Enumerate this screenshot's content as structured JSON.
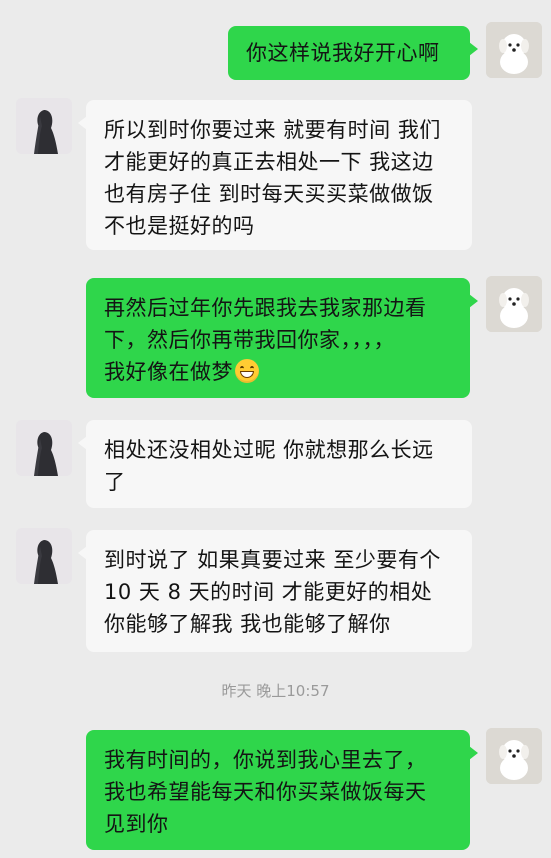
{
  "messages": [
    {
      "side": "right",
      "text": "你这样说我好开心啊"
    },
    {
      "side": "left",
      "lines": [
        "所以到时你要过来 就要有时间 我们",
        "才能更好的真正去相处一下 我这边",
        "也有房子住 到时每天买买菜做做饭",
        "不也是挺好的吗"
      ]
    },
    {
      "side": "right",
      "lines": [
        "再然后过年你先跟我去我家那边看",
        "下，然后你再带我回你家，，，，",
        "我好像在做梦"
      ],
      "emoji": "grinning-face-emoji"
    },
    {
      "side": "left",
      "lines": [
        "相处还没相处过昵 你就想那么长远",
        "了"
      ]
    },
    {
      "side": "left",
      "lines": [
        "到时说了 如果真要过来 至少要有个",
        "10 天 8 天的时间 才能更好的相处",
        "你能够了解我 我也能够了解你"
      ]
    },
    {
      "side": "right",
      "lines": [
        "我有时间的，你说到我心里去了，",
        "我也希望能每天和你买菜做饭每天",
        "见到你"
      ]
    }
  ],
  "timestamp": "昨天 晚上10:57",
  "avatars": {
    "self": "white-puppy-avatar",
    "contact": "girl-silhouette-avatar"
  },
  "colors": {
    "background": "#ebebeb",
    "outgoing_bubble": "#2fd64b",
    "incoming_bubble": "#f7f7f7",
    "timestamp_text": "#9a9a9a"
  }
}
